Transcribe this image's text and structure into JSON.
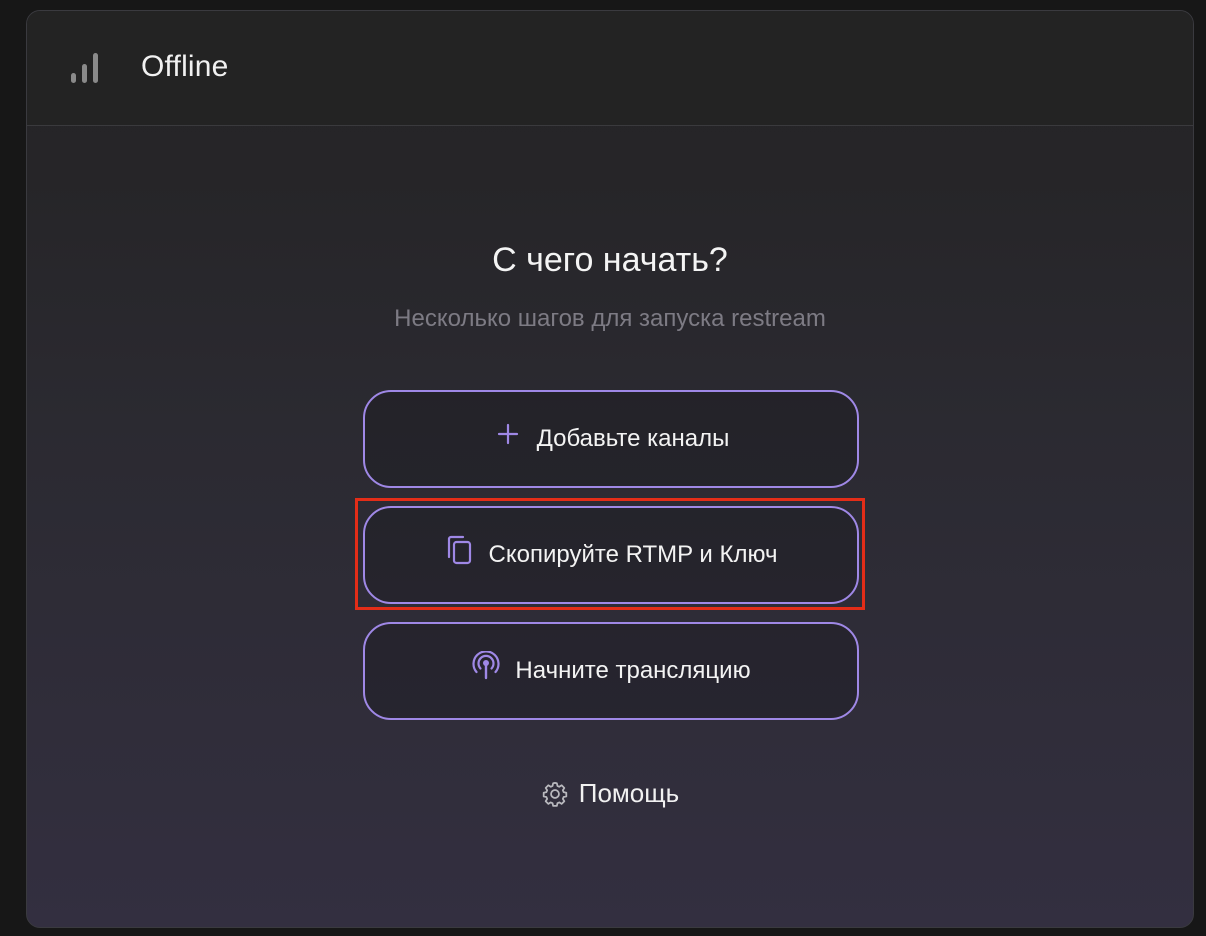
{
  "header": {
    "status": "Offline",
    "signal_icon": "signal-bars-icon"
  },
  "main": {
    "title": "С чего начать?",
    "subtitle": "Несколько шагов для запуска restream",
    "steps": [
      {
        "label": "Добавьте каналы",
        "icon": "plus-icon"
      },
      {
        "label": "Скопируйте RTMP и Ключ",
        "icon": "copy-icon"
      },
      {
        "label": "Начните трансляцию",
        "icon": "broadcast-icon"
      }
    ],
    "help_label": "Помощь",
    "help_icon": "gear-icon"
  },
  "colors": {
    "accent": "#9f88e6",
    "highlight": "#e32d18",
    "text": "#f1f1f1",
    "muted": "#7d7b84"
  }
}
